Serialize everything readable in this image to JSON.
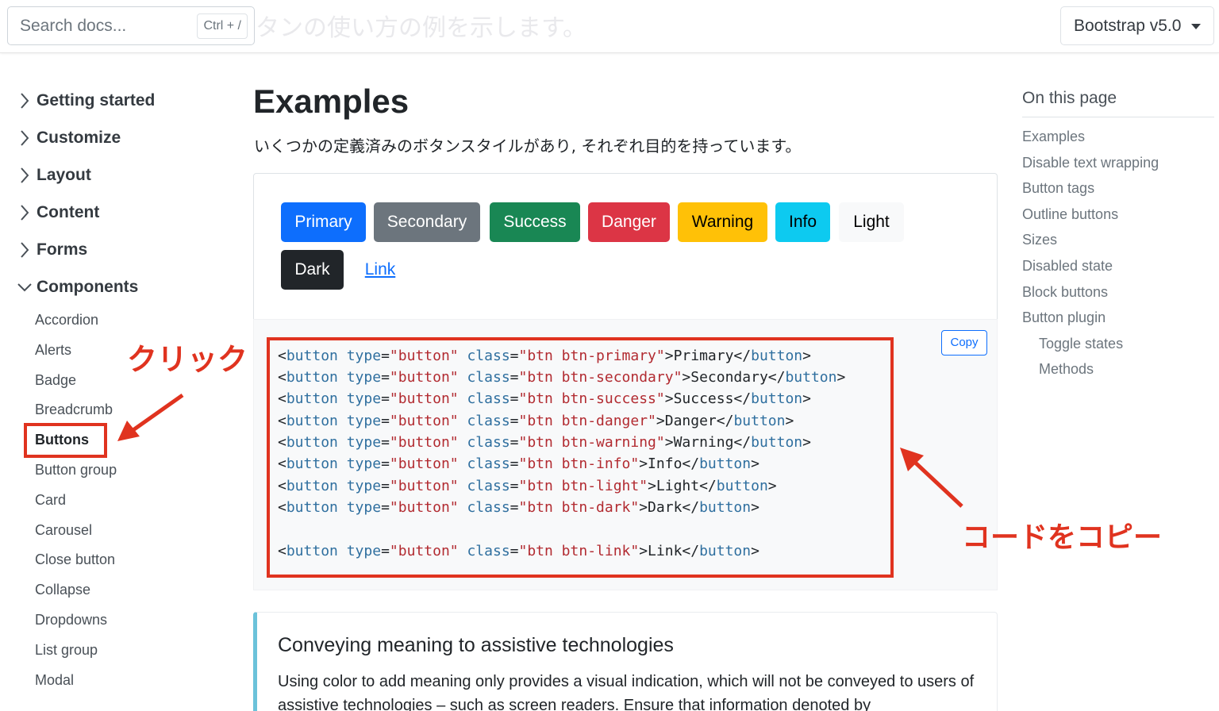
{
  "header": {
    "ghost_text": "タンの使い方の例を示します。",
    "search_placeholder": "Search docs...",
    "search_shortcut": "Ctrl + /",
    "version": "Bootstrap v5.0"
  },
  "sidebar": {
    "groups": [
      {
        "label": "Getting started",
        "expanded": false
      },
      {
        "label": "Customize",
        "expanded": false
      },
      {
        "label": "Layout",
        "expanded": false
      },
      {
        "label": "Content",
        "expanded": false
      },
      {
        "label": "Forms",
        "expanded": false
      },
      {
        "label": "Components",
        "expanded": true
      }
    ],
    "component_items": [
      "Accordion",
      "Alerts",
      "Badge",
      "Breadcrumb",
      "Buttons",
      "Button group",
      "Card",
      "Carousel",
      "Close button",
      "Collapse",
      "Dropdowns",
      "List group",
      "Modal"
    ],
    "active_item": "Buttons"
  },
  "annotations": {
    "click": "クリック",
    "copy_code": "コードをコピー",
    "color": "#e0331f"
  },
  "main": {
    "title": "Examples",
    "lead": "いくつかの定義済みのボタンスタイルがあり, それぞれ目的を持っています。",
    "buttons": [
      {
        "label": "Primary",
        "bg": "#0d6efd",
        "fg": "#ffffff"
      },
      {
        "label": "Secondary",
        "bg": "#6c757d",
        "fg": "#ffffff"
      },
      {
        "label": "Success",
        "bg": "#198754",
        "fg": "#ffffff"
      },
      {
        "label": "Danger",
        "bg": "#dc3545",
        "fg": "#ffffff"
      },
      {
        "label": "Warning",
        "bg": "#ffc107",
        "fg": "#000000"
      },
      {
        "label": "Info",
        "bg": "#0dcaf0",
        "fg": "#000000"
      },
      {
        "label": "Light",
        "bg": "#f8f9fa",
        "fg": "#000000"
      },
      {
        "label": "Dark",
        "bg": "#212529",
        "fg": "#ffffff"
      },
      {
        "label": "Link",
        "bg": "transparent",
        "fg": "#0d6efd"
      }
    ],
    "copy_label": "Copy",
    "code_lines": [
      {
        "cls": "btn btn-primary",
        "text": "Primary"
      },
      {
        "cls": "btn btn-secondary",
        "text": "Secondary"
      },
      {
        "cls": "btn btn-success",
        "text": "Success"
      },
      {
        "cls": "btn btn-danger",
        "text": "Danger"
      },
      {
        "cls": "btn btn-warning",
        "text": "Warning"
      },
      {
        "cls": "btn btn-info",
        "text": "Info"
      },
      {
        "cls": "btn btn-light",
        "text": "Light"
      },
      {
        "cls": "btn btn-dark",
        "text": "Dark"
      },
      {
        "cls": "btn btn-link",
        "text": "Link"
      }
    ],
    "callout_title": "Conveying meaning to assistive technologies",
    "callout_text": "Using color to add meaning only provides a visual indication, which will not be conveyed to users of assistive technologies – such as screen readers. Ensure that information denoted by"
  },
  "toc": {
    "title": "On this page",
    "items": [
      {
        "label": "Examples",
        "level": 1
      },
      {
        "label": "Disable text wrapping",
        "level": 1
      },
      {
        "label": "Button tags",
        "level": 1
      },
      {
        "label": "Outline buttons",
        "level": 1
      },
      {
        "label": "Sizes",
        "level": 1
      },
      {
        "label": "Disabled state",
        "level": 1
      },
      {
        "label": "Block buttons",
        "level": 1
      },
      {
        "label": "Button plugin",
        "level": 1
      },
      {
        "label": "Toggle states",
        "level": 2
      },
      {
        "label": "Methods",
        "level": 2
      }
    ]
  }
}
